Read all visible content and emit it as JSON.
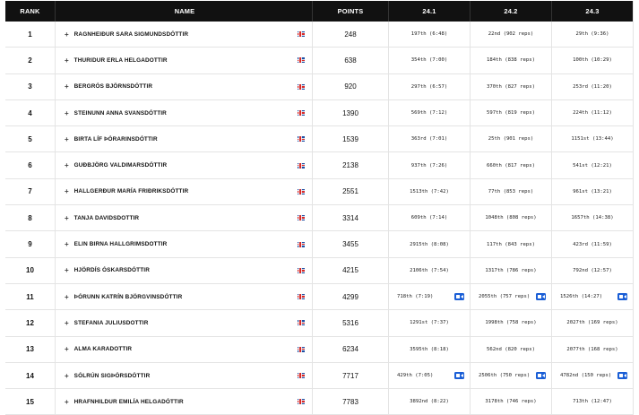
{
  "table": {
    "columns": [
      "RANK",
      "NAME",
      "POINTS",
      "24.1",
      "24.2",
      "24.3"
    ],
    "rows": [
      {
        "rank": "1",
        "name": "RAGNHEIÐUR SARA SIGMUNDSDÓTTIR",
        "points": "248",
        "e1": "197th (6:48)",
        "e2": "22nd (902 reps)",
        "e3": "29th (9:36)",
        "video": false
      },
      {
        "rank": "2",
        "name": "THURIDUR ERLA HELGADOTTIR",
        "points": "638",
        "e1": "354th (7:00)",
        "e2": "184th (838 reps)",
        "e3": "100th (10:29)",
        "video": false
      },
      {
        "rank": "3",
        "name": "BERGRÓS BJÖRNSDÓTTIR",
        "points": "920",
        "e1": "297th (6:57)",
        "e2": "370th (827 reps)",
        "e3": "253rd (11:20)",
        "video": false
      },
      {
        "rank": "4",
        "name": "STEINUNN ANNA SVANSDÓTTIR",
        "points": "1390",
        "e1": "569th (7:12)",
        "e2": "597th (819 reps)",
        "e3": "224th (11:12)",
        "video": false
      },
      {
        "rank": "5",
        "name": "BIRTA LÍF ÞÓRARINSDÓTTIR",
        "points": "1539",
        "e1": "363rd (7:01)",
        "e2": "25th (901 reps)",
        "e3": "1151st (13:44)",
        "video": false
      },
      {
        "rank": "6",
        "name": "GUÐBJÖRG VALDIMARSDÓTTIR",
        "points": "2138",
        "e1": "937th (7:26)",
        "e2": "660th (817 reps)",
        "e3": "541st (12:21)",
        "video": false
      },
      {
        "rank": "7",
        "name": "HALLGERÐUR MARÍA FRIÐRIKSDÓTTIR",
        "points": "2551",
        "e1": "1513th (7:42)",
        "e2": "77th (853 reps)",
        "e3": "961st (13:21)",
        "video": false
      },
      {
        "rank": "8",
        "name": "TANJA DAVIDSDOTTIR",
        "points": "3314",
        "e1": "609th (7:14)",
        "e2": "1048th (808 reps)",
        "e3": "1657th (14:38)",
        "video": false
      },
      {
        "rank": "9",
        "name": "ELIN BIRNA HALLGRIMSDOTTIR",
        "points": "3455",
        "e1": "2915th (8:08)",
        "e2": "117th (843 reps)",
        "e3": "423rd (11:59)",
        "video": false
      },
      {
        "rank": "10",
        "name": "HJÖRDÍS ÓSKARSDÓTTIR",
        "points": "4215",
        "e1": "2106th (7:54)",
        "e2": "1317th (786 reps)",
        "e3": "792nd (12:57)",
        "video": false
      },
      {
        "rank": "11",
        "name": "ÞÓRUNN KATRÍN BJÖRGVINSDÓTTIR",
        "points": "4299",
        "e1": "718th (7:19)",
        "e2": "2055th (757 reps)",
        "e3": "1526th (14:27)",
        "video": true
      },
      {
        "rank": "12",
        "name": "STEFANIA JULIUSDOTTIR",
        "points": "5316",
        "e1": "1291st (7:37)",
        "e2": "1998th (758 reps)",
        "e3": "2027th (169 reps)",
        "video": false
      },
      {
        "rank": "13",
        "name": "ALMA KARADOTTIR",
        "points": "6234",
        "e1": "3595th (8:18)",
        "e2": "562nd (820 reps)",
        "e3": "2077th (168 reps)",
        "video": false
      },
      {
        "rank": "14",
        "name": "SÓLRÚN SIGÞÓRSDÓTTIR",
        "points": "7717",
        "e1": "429th (7:05)",
        "e2": "2506th (750 reps)",
        "e3": "4782nd (150 reps)",
        "video": true
      },
      {
        "rank": "15",
        "name": "HRAFNHILDUR EMILÍA HELGADÓTTIR",
        "points": "7783",
        "e1": "3892nd (8:22)",
        "e2": "3178th (746 reps)",
        "e3": "713th (12:47)",
        "video": false
      }
    ]
  },
  "icons": {
    "expand": "plus-icon",
    "flag": "iceland-flag-icon",
    "video": "video-icon"
  },
  "colors": {
    "header_bg": "#111111",
    "video_blue": "#1a5ed6"
  }
}
